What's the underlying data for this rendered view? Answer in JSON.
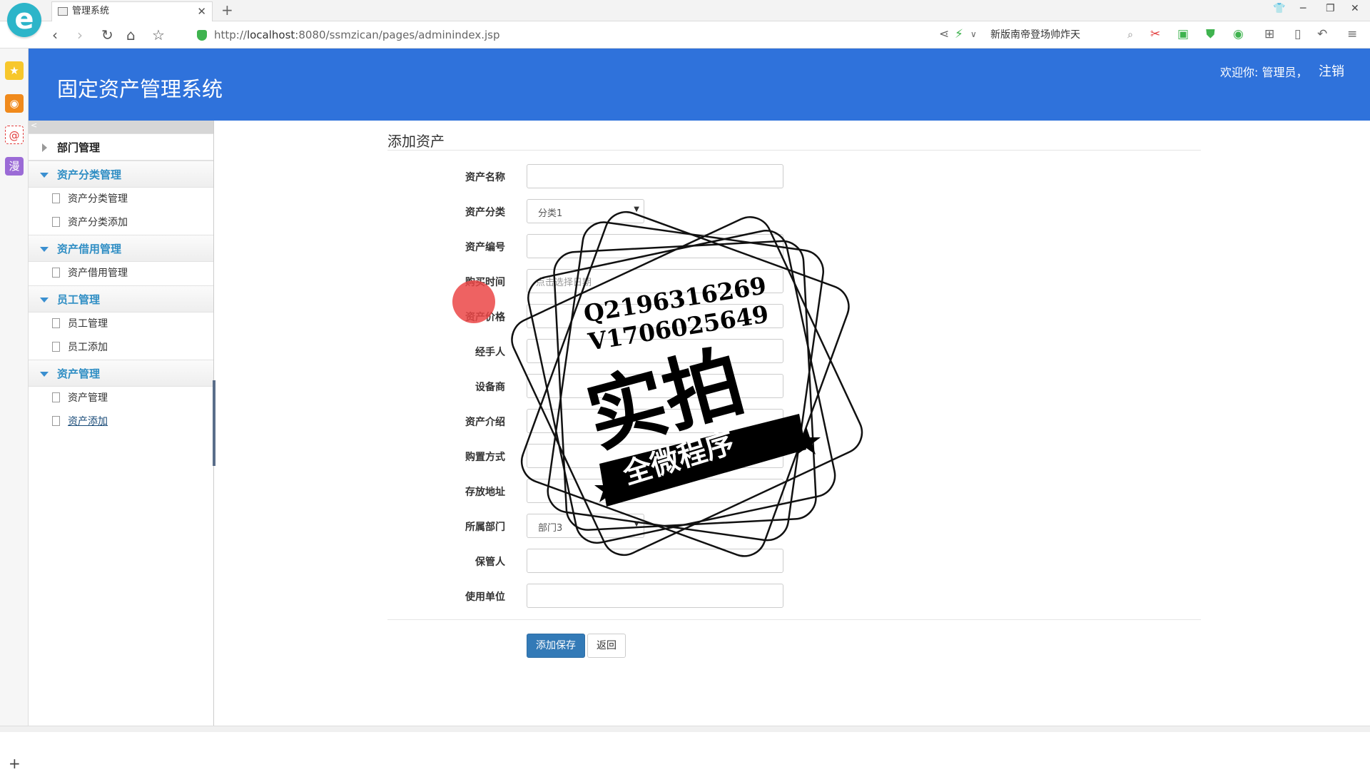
{
  "browser": {
    "tab_title": "管理系统",
    "url_prefix": "http://",
    "url_host": "localhost",
    "url_path": ":8080/ssmzican/pages/adminindex.jsp",
    "search_text": "新版南帝登场帅炸天"
  },
  "header": {
    "title": "固定资产管理系统",
    "welcome": "欢迎你: 管理员，",
    "logout": "注销"
  },
  "menu": {
    "collapse": "<",
    "groups": [
      {
        "label": "部门管理",
        "items": []
      },
      {
        "label": "资产分类管理",
        "items": [
          "资产分类管理",
          "资产分类添加"
        ]
      },
      {
        "label": "资产借用管理",
        "items": [
          "资产借用管理"
        ]
      },
      {
        "label": "员工管理",
        "items": [
          "员工管理",
          "员工添加"
        ]
      },
      {
        "label": "资产管理",
        "items": [
          "资产管理",
          "资产添加"
        ]
      }
    ]
  },
  "form": {
    "title": "添加资产",
    "fields": {
      "name": "资产名称",
      "category": "资产分类",
      "code": "资产编号",
      "purchase_time": "购买时间",
      "price": "资产价格",
      "handler": "经手人",
      "supplier": "设备商",
      "intro": "资产介绍",
      "purchase_method": "购置方式",
      "location": "存放地址",
      "department": "所属部门",
      "keeper": "保管人",
      "unit": "使用单位"
    },
    "category_value": "分类1",
    "date_placeholder": "点击选择日期",
    "department_value": "部门3",
    "save_button": "添加保存",
    "back_button": "返回"
  },
  "watermark": {
    "qq": "Q2196316269",
    "v": "V1706025649",
    "big": "实拍",
    "band": "全微程序"
  }
}
